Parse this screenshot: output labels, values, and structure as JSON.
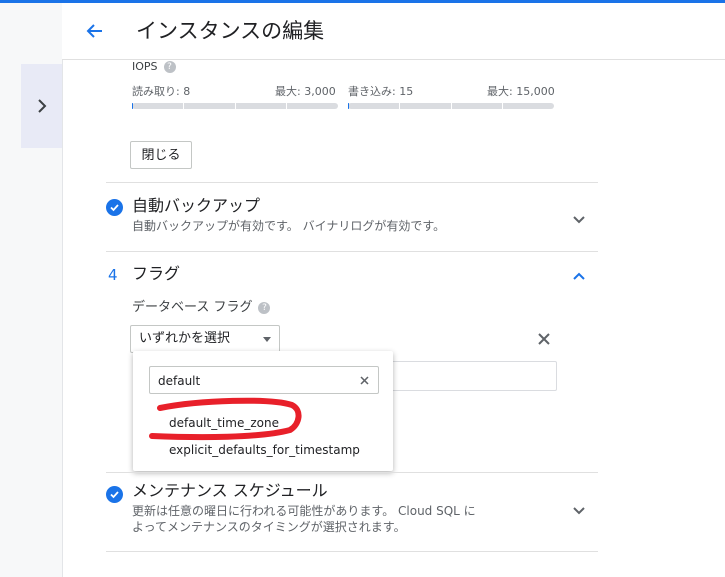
{
  "header": {
    "title": "インスタンスの編集",
    "back_icon": "arrow-back-icon"
  },
  "sidebar": {
    "expand_icon": "chevron-right-icon"
  },
  "iops": {
    "label": "IOPS",
    "read": {
      "label": "読み取り: 8",
      "max": "最大: 3,000",
      "fraction": 0.0027
    },
    "write": {
      "label": "書き込み: 15",
      "max": "最大: 15,000",
      "fraction": 0.001
    }
  },
  "close_button": "閉じる",
  "backup": {
    "title": "自動バックアップ",
    "subtitle": "自動バックアップが有効です。 バイナリログが有効です。"
  },
  "flags": {
    "step": "4",
    "title": "フラグ",
    "db_flag_label": "データベース フラグ",
    "select_placeholder": "いずれかを選択",
    "dropdown": {
      "search_value": "default",
      "options": [
        "default_time_zone",
        "explicit_defaults_for_timestamp"
      ]
    }
  },
  "maintenance": {
    "title": "メンテナンス スケジュール",
    "subtitle_line1": "更新は任意の曜日に行われる可能性があります。 Cloud SQL に",
    "subtitle_line2": "よってメンテナンスのタイミングが選択されます。"
  },
  "colors": {
    "accent": "#1a73e8",
    "annotation": "#e8202a"
  }
}
